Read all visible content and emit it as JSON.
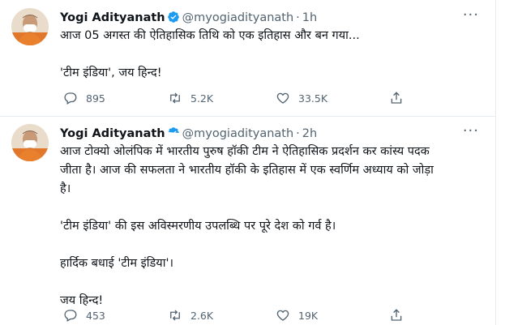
{
  "tweets": [
    {
      "author_name": "Yogi Adityanath",
      "handle": "@myogiadityanath",
      "separator": "·",
      "time": "1h",
      "more": "···",
      "text": "आज 05 अगस्त की ऐतिहासिक तिथि को एक इतिहास और बन गया...\n\n'टीम इंडिया', जय हिन्द!",
      "replies": "895",
      "retweets": "5.2K",
      "likes": "33.5K"
    },
    {
      "author_name": "Yogi Adityanath",
      "handle": "@myogiadityanath",
      "separator": "·",
      "time": "2h",
      "more": "···",
      "text": "आज टोक्यो ओलंपिक में भारतीय पुरुष हॉकी टीम ने ऐतिहासिक प्रदर्शन कर कांस्य पदक\nजीता है। आज की सफलता ने भारतीय हॉकी के इतिहास में एक स्वर्णिम अध्याय को जोड़ा\nहै।\n\n'टीम इंडिया' की इस अविस्मरणीय उपलब्धि पर पूरे देश को गर्व है।\n\nहार्दिक बधाई 'टीम इंडिया'।\n\nजय हिन्द!",
      "replies": "453",
      "retweets": "2.6K",
      "likes": "19K"
    }
  ],
  "icons": {
    "verified": "verified-badge-icon",
    "reply": "reply-icon",
    "retweet": "retweet-icon",
    "like": "heart-icon",
    "share": "share-icon"
  },
  "colors": {
    "verified": "#1d9bf0",
    "secondary_text": "#536471",
    "divider": "#e6ecf0"
  }
}
